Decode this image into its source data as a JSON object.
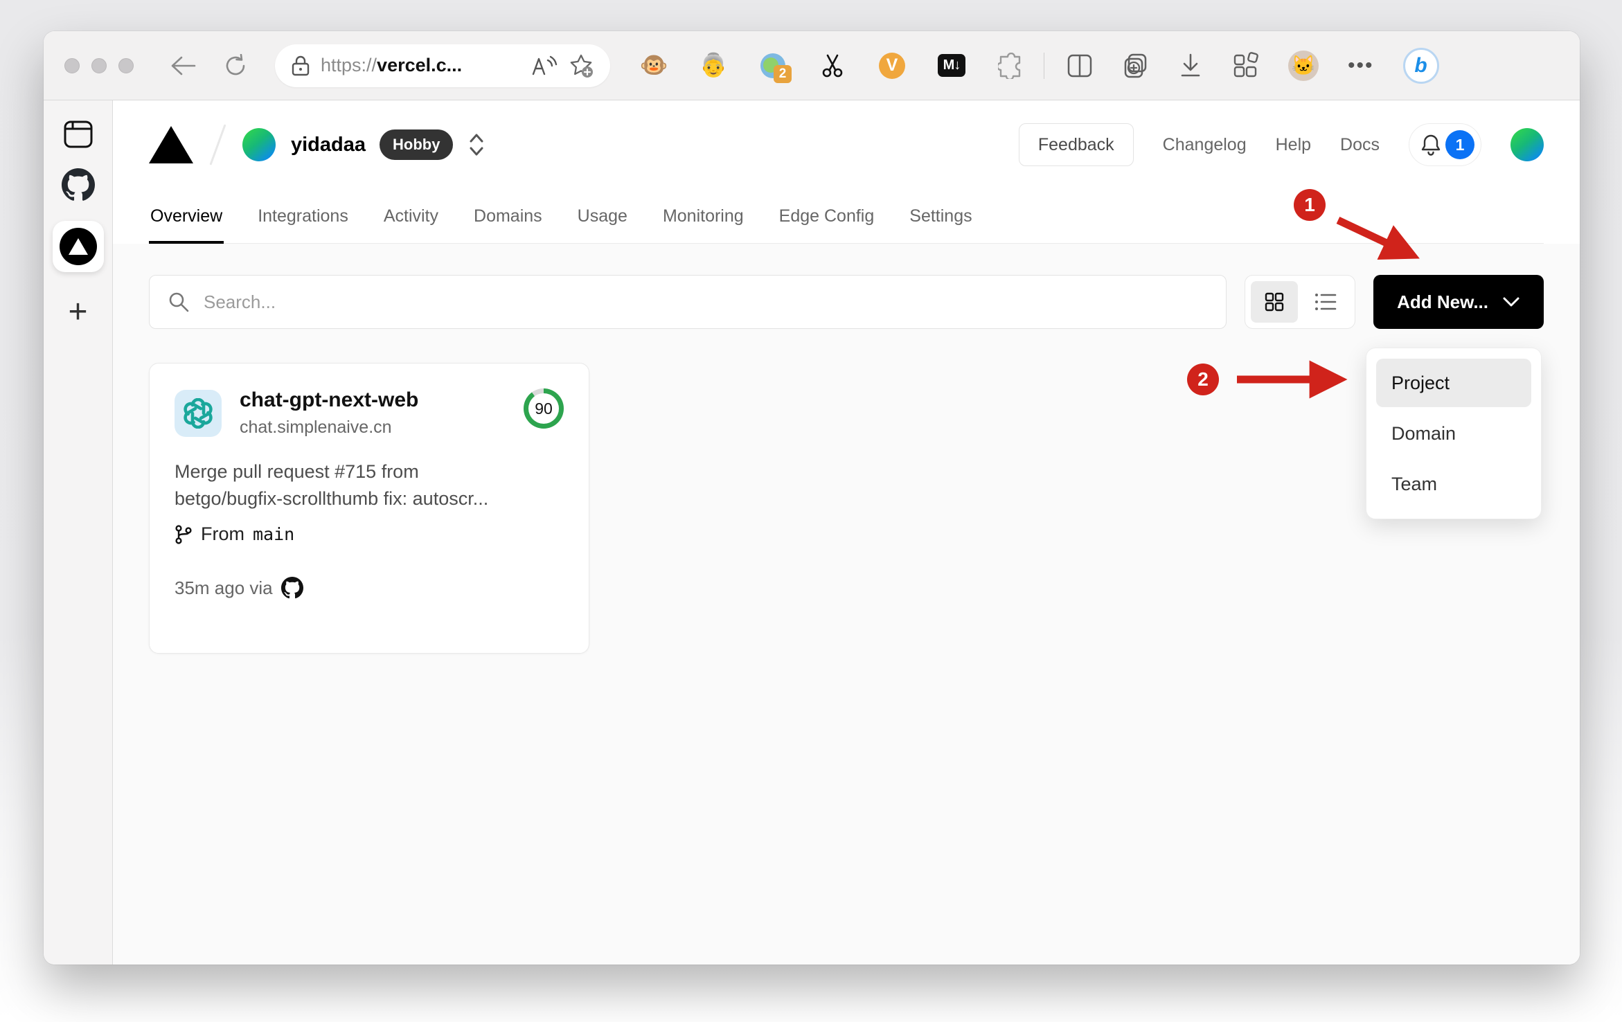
{
  "browser": {
    "url": {
      "scheme": "https://",
      "host": "vercel.c..."
    },
    "extensions": [
      {
        "name": "tampermonkey",
        "glyph": "🐵"
      },
      {
        "name": "user-avatar-extension",
        "glyph": "👵"
      },
      {
        "name": "proxy-extension",
        "badge": "2"
      },
      {
        "name": "clipper-extension",
        "glyph": ""
      },
      {
        "name": "vimium",
        "glyph": "V"
      },
      {
        "name": "markdown-download",
        "glyph": "M↓"
      }
    ],
    "bing_glyph": "b"
  },
  "sidebar": {
    "active_site": "vercel"
  },
  "header": {
    "team": "yidadaa",
    "plan_badge": "Hobby",
    "feedback": "Feedback",
    "links": [
      {
        "label": "Changelog"
      },
      {
        "label": "Help"
      },
      {
        "label": "Docs"
      }
    ],
    "notification_count": "1",
    "tabs": [
      {
        "label": "Overview",
        "active": true
      },
      {
        "label": "Integrations"
      },
      {
        "label": "Activity"
      },
      {
        "label": "Domains"
      },
      {
        "label": "Usage"
      },
      {
        "label": "Monitoring"
      },
      {
        "label": "Edge Config"
      },
      {
        "label": "Settings"
      }
    ]
  },
  "controls": {
    "search_placeholder": "Search...",
    "add_new": "Add New..."
  },
  "project_card": {
    "name": "chat-gpt-next-web",
    "domain": "chat.simplenaive.cn",
    "score": "90",
    "commit_line1": "Merge pull request #715 from",
    "commit_line2": "betgo/bugfix-scrollthumb fix: autoscr...",
    "from_label": "From",
    "branch": "main",
    "deployed": "35m ago via"
  },
  "dropdown": {
    "items": [
      {
        "label": "Project",
        "highlighted": true
      },
      {
        "label": "Domain"
      },
      {
        "label": "Team"
      }
    ]
  },
  "annotations": {
    "step1": "1",
    "step2": "2"
  },
  "colors": {
    "annotation_red": "#d0231b",
    "notification_blue": "#0b72f5",
    "score_green": "#2da44e",
    "openai_teal": "#1aa79b"
  }
}
